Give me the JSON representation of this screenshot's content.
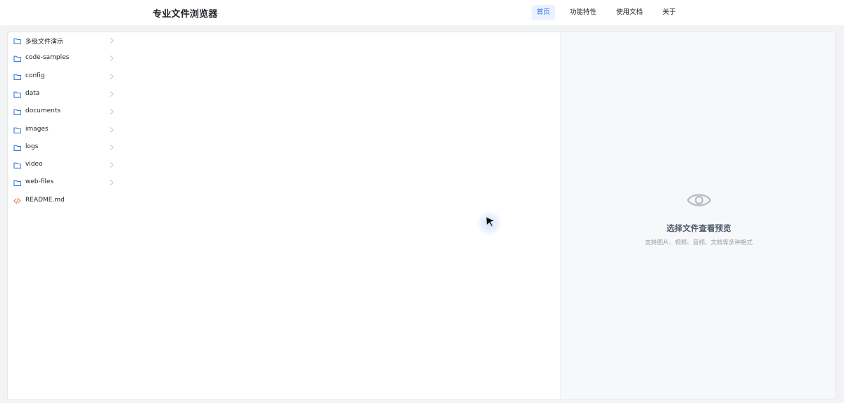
{
  "header": {
    "title": "专业文件浏览器",
    "nav": [
      {
        "label": "首页",
        "active": true
      },
      {
        "label": "功能特性",
        "active": false
      },
      {
        "label": "使用文档",
        "active": false
      },
      {
        "label": "关于",
        "active": false
      }
    ]
  },
  "file_tree": {
    "items": [
      {
        "name": "多级文件演示",
        "type": "folder",
        "icon": "folder-icon",
        "expandable": true
      },
      {
        "name": "code-samples",
        "type": "folder",
        "icon": "folder-icon",
        "expandable": true
      },
      {
        "name": "config",
        "type": "folder",
        "icon": "folder-icon",
        "expandable": true
      },
      {
        "name": "data",
        "type": "folder",
        "icon": "folder-icon",
        "expandable": true
      },
      {
        "name": "documents",
        "type": "folder",
        "icon": "folder-icon",
        "expandable": true
      },
      {
        "name": "images",
        "type": "folder",
        "icon": "folder-icon",
        "expandable": true
      },
      {
        "name": "logs",
        "type": "folder",
        "icon": "folder-icon",
        "expandable": true
      },
      {
        "name": "video",
        "type": "folder",
        "icon": "folder-icon",
        "expandable": true
      },
      {
        "name": "web-files",
        "type": "folder",
        "icon": "folder-icon",
        "expandable": true
      },
      {
        "name": "README.md",
        "type": "file",
        "icon": "code-file-icon",
        "expandable": false
      }
    ]
  },
  "preview": {
    "icon": "eye-icon",
    "title": "选择文件查看预览",
    "subtitle": "支持图片、视频、音频、文档等多种格式"
  },
  "colors": {
    "accent": "#2b6ef0",
    "folder_icon": "#3b7bd8",
    "file_icon": "#e8793a",
    "preview_bg": "#f7f8fa"
  }
}
